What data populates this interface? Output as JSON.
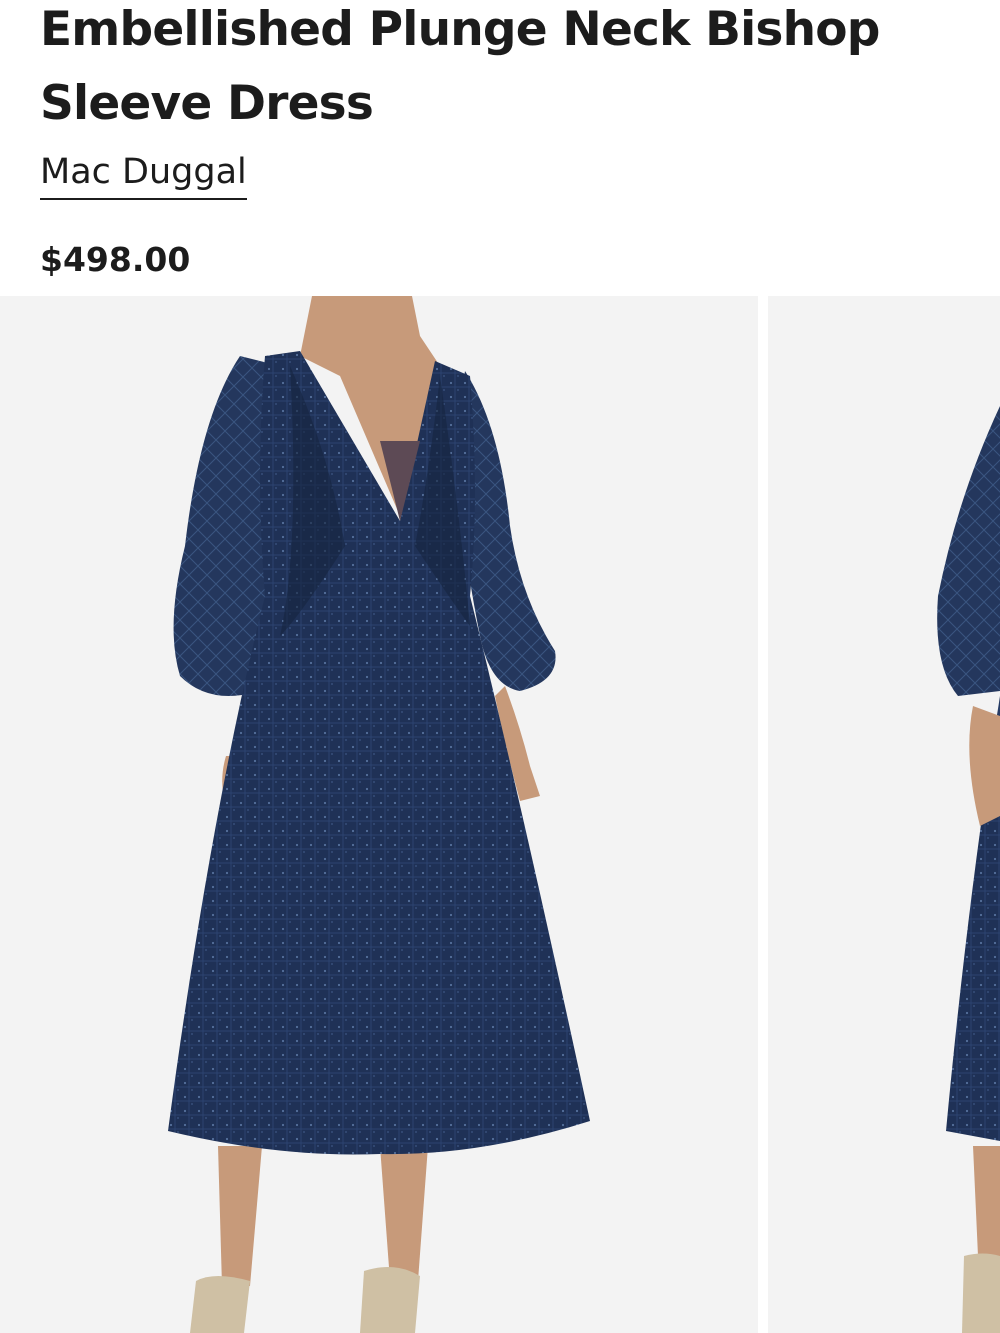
{
  "product": {
    "title": "Embellished Plunge Neck Bishop Sleeve Dress",
    "brand": "Mac Duggal",
    "price": "$498.00"
  },
  "gallery": {
    "images": [
      {
        "alt": "Navy embellished dress, front view"
      },
      {
        "alt": "Navy embellished dress, side view"
      }
    ],
    "colors": {
      "background": "#f3f3f3",
      "dress": "#1f3156",
      "skin": "#c79a7a"
    }
  }
}
